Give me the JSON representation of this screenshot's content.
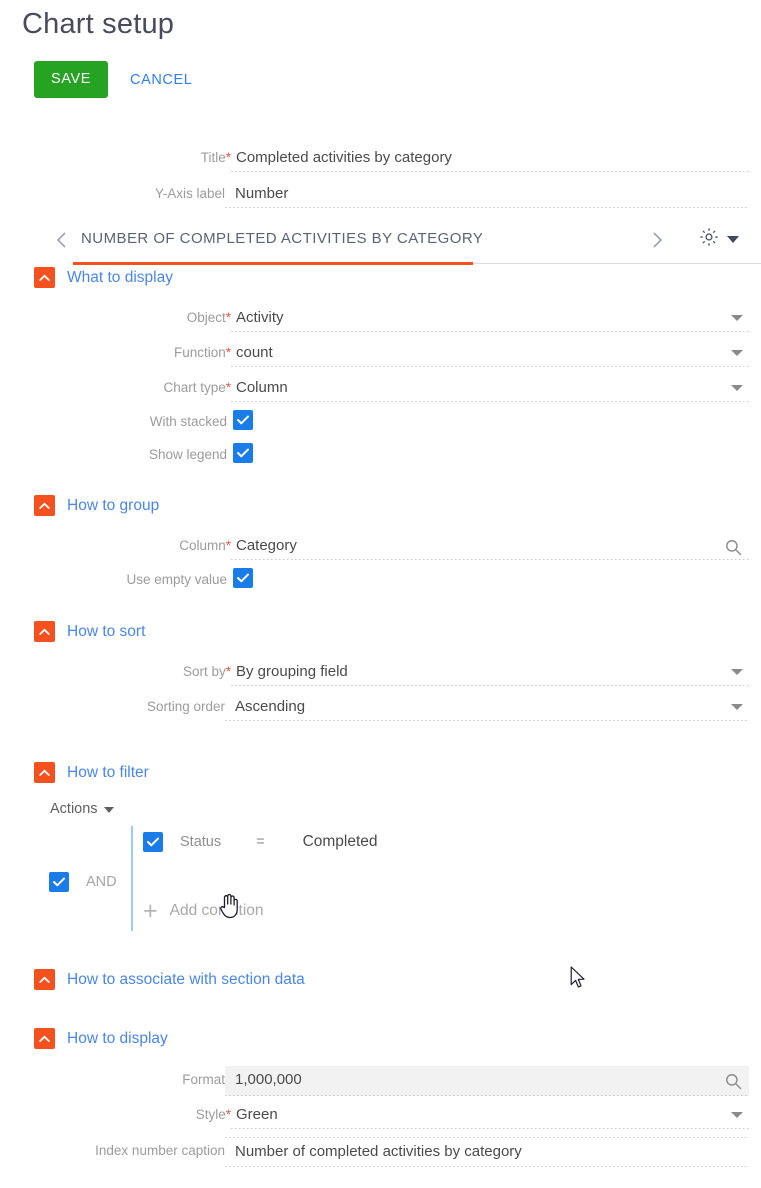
{
  "header": {
    "title": "Chart setup",
    "save_label": "SAVE",
    "cancel_label": "CANCEL"
  },
  "colors": {
    "save_green": "#27a324",
    "link_blue": "#4a86e8",
    "accent_orange": "#f4511e",
    "checkbox_blue": "#1a7ce8",
    "required_red": "#e8573f"
  },
  "top_fields": {
    "title": {
      "label": "Title",
      "required": true,
      "value": "Completed activities by category"
    },
    "y_axis": {
      "label": "Y-Axis label",
      "required": false,
      "value": "Number"
    }
  },
  "tabstrip": {
    "label": "NUMBER OF COMPLETED ACTIVITIES BY CATEGORY",
    "prev_icon": "chevron-left-icon",
    "next_icon": "chevron-right-icon",
    "settings_icon": "gear-icon",
    "settings_caret": "caret-down-icon"
  },
  "sections": {
    "what_to_display": {
      "title": "What to display",
      "collapse_icon": "chevron-up-icon",
      "fields": {
        "object": {
          "label": "Object",
          "required": true,
          "value": "Activity",
          "control": "dropdown"
        },
        "function": {
          "label": "Function",
          "required": true,
          "value": "count",
          "control": "dropdown"
        },
        "chart_type": {
          "label": "Chart type",
          "required": true,
          "value": "Column",
          "control": "dropdown"
        }
      },
      "checkboxes": {
        "with_stacked": {
          "label": "With stacked",
          "checked": true
        },
        "show_legend": {
          "label": "Show legend",
          "checked": true
        }
      }
    },
    "how_to_group": {
      "title": "How to group",
      "collapse_icon": "chevron-up-icon",
      "fields": {
        "column": {
          "label": "Column",
          "required": true,
          "value": "Category",
          "control": "lookup"
        }
      },
      "checkboxes": {
        "use_empty_value": {
          "label": "Use empty value",
          "checked": true
        }
      }
    },
    "how_to_sort": {
      "title": "How to sort",
      "collapse_icon": "chevron-up-icon",
      "fields": {
        "sort_by": {
          "label": "Sort by",
          "required": true,
          "value": "By grouping field",
          "control": "dropdown"
        },
        "sorting_order": {
          "label": "Sorting order",
          "required": false,
          "value": "Ascending",
          "control": "dropdown"
        }
      }
    },
    "how_to_filter": {
      "title": "How to filter",
      "collapse_icon": "chevron-up-icon",
      "actions_label": "Actions",
      "logic_operator": {
        "label": "AND",
        "checked": true
      },
      "conditions": [
        {
          "checked": true,
          "field": "Status",
          "operator": "=",
          "value": "Completed"
        }
      ],
      "add_condition_label": "Add condition",
      "add_condition_icon": "plus-icon"
    },
    "how_to_associate": {
      "title": "How to associate with section data",
      "collapse_icon": "chevron-up-icon"
    },
    "how_to_display": {
      "title": "How to display",
      "collapse_icon": "chevron-up-icon",
      "fields": {
        "format": {
          "label": "Format",
          "required": false,
          "value": "1,000,000",
          "control": "lookup"
        },
        "style": {
          "label": "Style",
          "required": true,
          "value": "Green",
          "control": "dropdown"
        },
        "index_number_caption": {
          "label": "Index number caption",
          "required": false,
          "value": "Number of completed activities by category",
          "control": "text"
        }
      }
    }
  }
}
